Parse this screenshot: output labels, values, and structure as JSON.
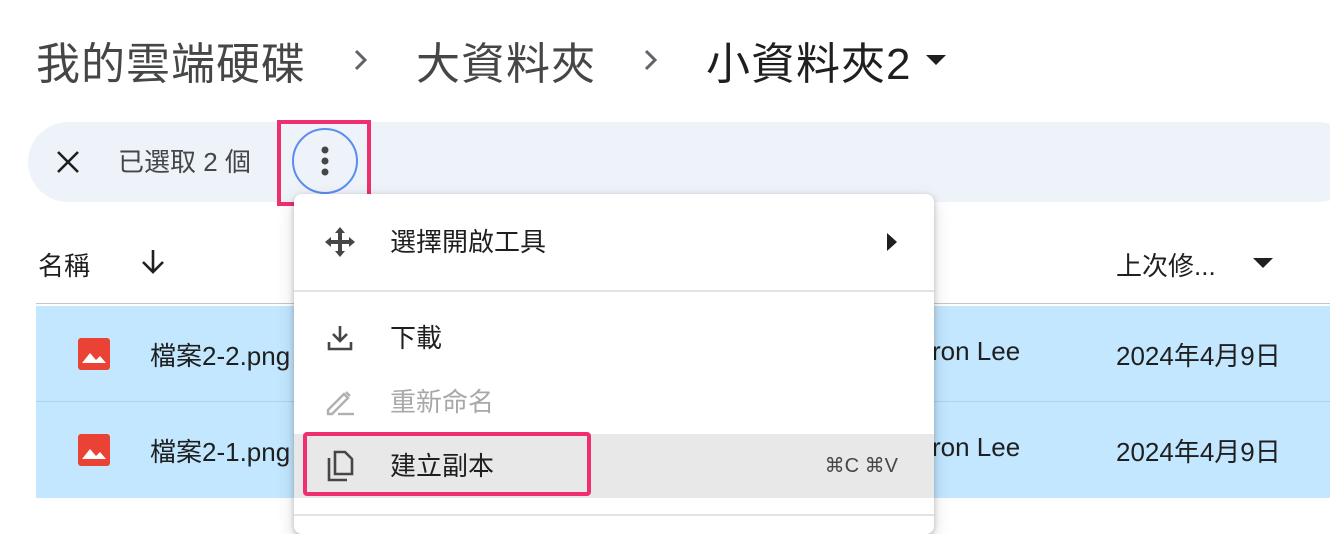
{
  "breadcrumb": {
    "items": [
      "我的雲端硬碟",
      "大資料夾",
      "小資料夾2"
    ]
  },
  "selection_bar": {
    "count_label": "已選取 2 個",
    "icons": {
      "close": "close-icon",
      "more": "more-vert-icon"
    }
  },
  "table": {
    "columns": {
      "name": "名稱",
      "modified": "上次修..."
    },
    "rows": [
      {
        "name": "檔案2-2.png",
        "owner": "ron Lee",
        "modified": "2024年4月9日",
        "icon": "image-file-icon"
      },
      {
        "name": "檔案2-1.png",
        "owner": "ron Lee",
        "modified": "2024年4月9日",
        "icon": "image-file-icon"
      }
    ]
  },
  "context_menu": {
    "open_with": {
      "label": "選擇開啟工具",
      "icon": "open-with-icon"
    },
    "download": {
      "label": "下載",
      "icon": "download-icon"
    },
    "rename": {
      "label": "重新命名",
      "icon": "rename-icon",
      "disabled": true
    },
    "make_copy": {
      "label": "建立副本",
      "icon": "copy-icon",
      "shortcut": "⌘C ⌘V"
    }
  },
  "colors": {
    "selection_bar_bg": "#eef2f9",
    "selected_row_bg": "#c2e7ff",
    "highlight_border": "#f0306e",
    "image_icon": "#ea4335",
    "focus_ring": "#5b8def"
  }
}
